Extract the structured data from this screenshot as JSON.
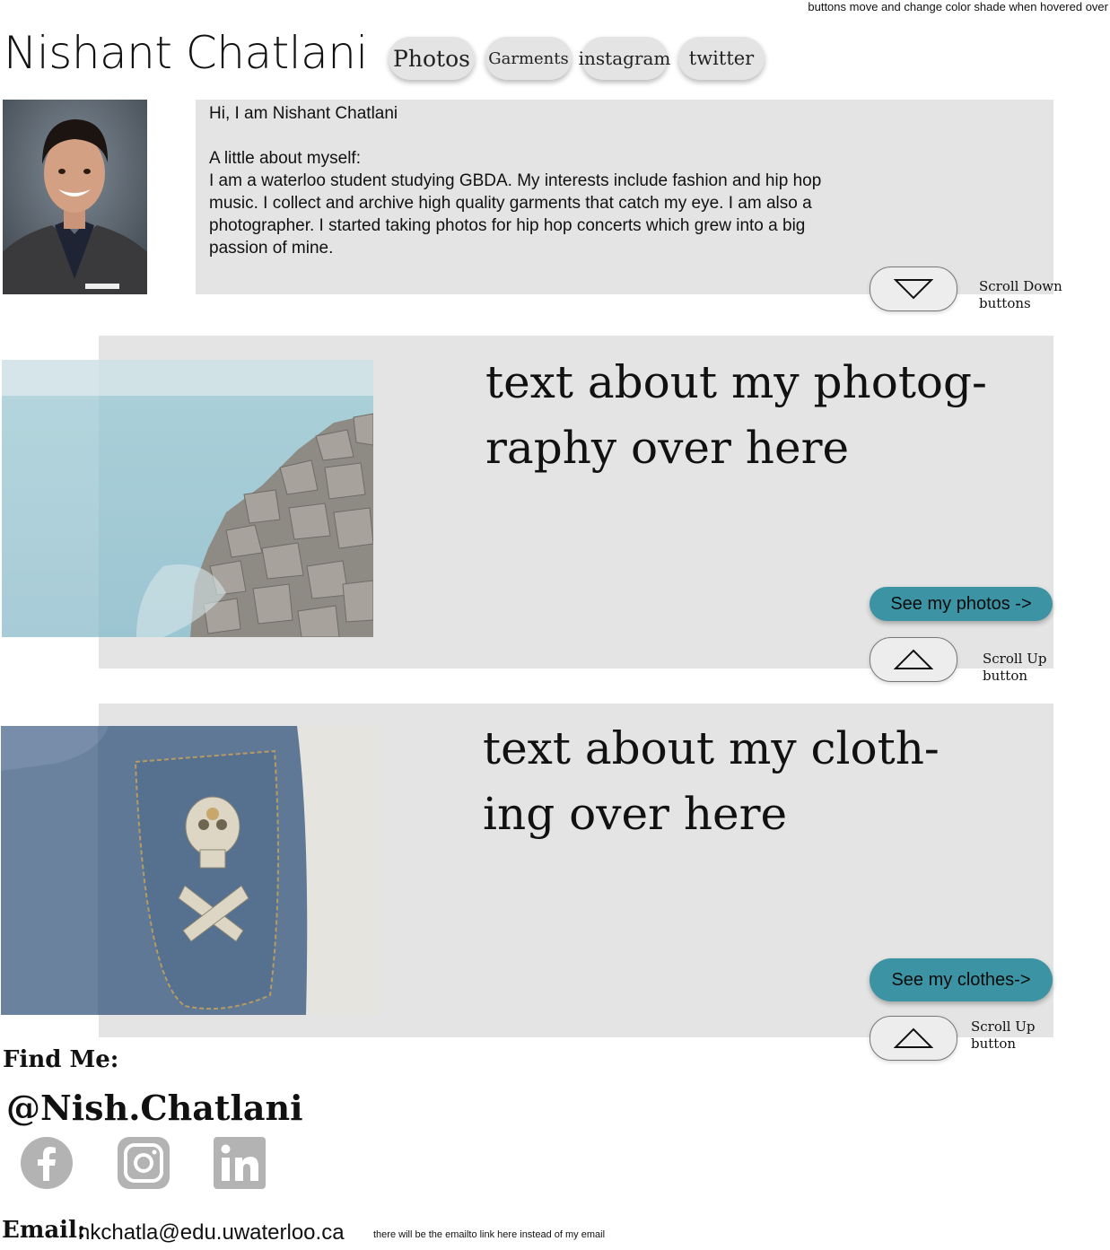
{
  "top_note": "buttons move and change color shade when hovered over",
  "header": {
    "site_title": "Nishant Chatlani",
    "nav": [
      "Photos",
      "Garments",
      "instagram",
      "twitter"
    ]
  },
  "about": {
    "greeting": "Hi, I am Nishant Chatlani",
    "subtitle": "A little about myself:",
    "body": "I am a waterloo student studying GBDA.  My interests include fashion and hip hop music. I collect  and archive high quality garments that catch my eye.  I am also a photographer.  I started taking photos for hip hop concerts which grew into a big passion of mine.",
    "scroll_note": [
      "Scroll Down",
      "buttons"
    ]
  },
  "photography": {
    "heading": "text about my photog- raphy over here",
    "heading_lines": [
      "text about my photog-",
      "raphy over here"
    ],
    "cta": "See my photos ->",
    "scroll_note": [
      "Scroll Up",
      "button"
    ]
  },
  "clothing": {
    "heading_lines": [
      "text about my cloth-",
      "ing over here"
    ],
    "cta": "See my clothes->",
    "scroll_note": [
      "Scroll Up",
      "button"
    ]
  },
  "footer": {
    "find_me": "Find Me:",
    "handle": "@Nish.Chatlani",
    "social_icons": [
      "facebook-icon",
      "instagram-icon",
      "linkedin-icon"
    ],
    "email_label": "Email:",
    "email": "nkchatla@edu.uwaterloo.ca",
    "email_note": "there will be the emailto link here instead of my email"
  },
  "colors": {
    "panel": "#e4e4e4",
    "cta": "#3b93a3",
    "social_icon": "#b3b3b3"
  }
}
